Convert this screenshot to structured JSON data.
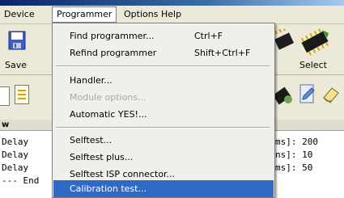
{
  "menubar": {
    "items": [
      "Device",
      "Programmer",
      "Options",
      "Help"
    ]
  },
  "toolbar": {
    "save_label": "Save",
    "select_label": "Select",
    "select_dot": "."
  },
  "panel": {
    "header": "w"
  },
  "log": {
    "lines": [
      "Delay",
      "Delay",
      "Delay",
      "--- End"
    ],
    "right_lines": [
      "ms]: 200",
      "ns]: 10",
      "ms]: 50"
    ]
  },
  "programmer_menu": {
    "items": [
      {
        "label": "Find programmer...",
        "shortcut": "Ctrl+F"
      },
      {
        "label": "Refind programmer",
        "shortcut": "Shift+Ctrl+F"
      },
      {
        "label": "Handler..."
      },
      {
        "label": "Module options...",
        "disabled": true
      },
      {
        "label": "Automatic YES!..."
      },
      {
        "label": "Selftest..."
      },
      {
        "label": "Selftest plus..."
      },
      {
        "label": "Selftest ISP connector..."
      },
      {
        "label": "Calibration test...",
        "selected": true
      }
    ]
  },
  "colors": {
    "menu_highlight": "#316ac5",
    "toolbar_bg": "#ece9d8",
    "menu_bg": "#f0efe9"
  }
}
